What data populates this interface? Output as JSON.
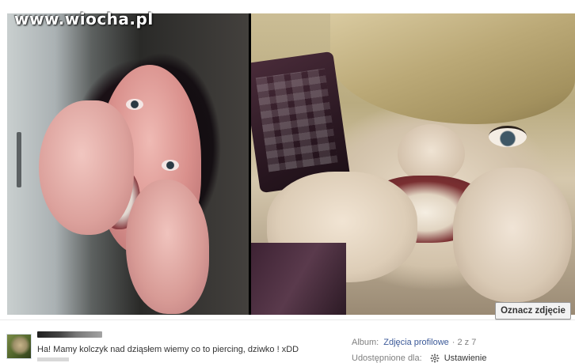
{
  "watermark": {
    "text": "www.wiocha.pl"
  },
  "photo": {
    "tag_button_label": "Oznacz zdjęcie"
  },
  "post": {
    "author_name_blurred": "",
    "caption": "Ha! Mamy kolczyk nad dziąsłem wiemy co to piercing, dziwko ! xDD"
  },
  "meta": {
    "album_label": "Album:",
    "album_name": "Zdjęcia profilowe",
    "separator": "·",
    "position": "2 z 7",
    "privacy_label": "Udostępnione dla:",
    "privacy_icon": "gear-icon",
    "privacy_value": "Ustawienie"
  },
  "colors": {
    "link": "#3b5998",
    "meta_text": "#808080",
    "body_text": "#333333"
  }
}
